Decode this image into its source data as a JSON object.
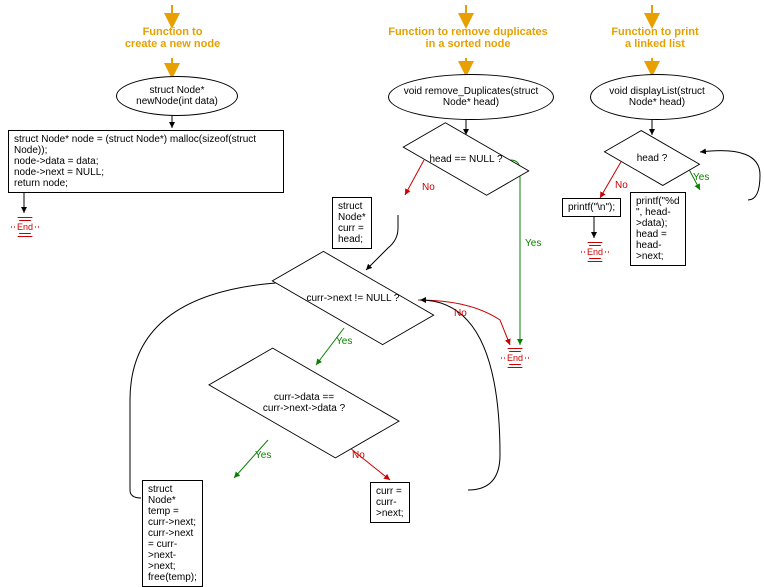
{
  "labels": {
    "yes": "Yes",
    "no": "No",
    "end": "End"
  },
  "newNode": {
    "title": "Function to\ncreate a new node",
    "signature": "struct Node*\nnewNode(int data)",
    "body": "struct Node* node = (struct Node*) malloc(sizeof(struct Node));\nnode->data = data;\nnode->next = NULL;\nreturn node;"
  },
  "removeDuplicates": {
    "title": "Function to remove duplicates\nin a sorted node",
    "signature": "void remove_Duplicates(struct\nNode* head)",
    "cond_head": "head == NULL ?",
    "init_curr": "struct Node* curr = head;",
    "cond_next": "curr->next != NULL ?",
    "cond_data": "curr->data ==\ncurr->next->data ?",
    "remove_code": "struct Node* temp = curr->next;\ncurr->next = curr->next->next;\nfree(temp);",
    "advance_code": "curr = curr->next;"
  },
  "displayList": {
    "title": "Function to print\na linked list",
    "signature": "void displayList(struct\nNode* head)",
    "cond_head": "head ?",
    "print_newline": "printf(\"\\n\");",
    "print_node": "printf(\"%d \", head->data);\nhead = head->next;"
  }
}
